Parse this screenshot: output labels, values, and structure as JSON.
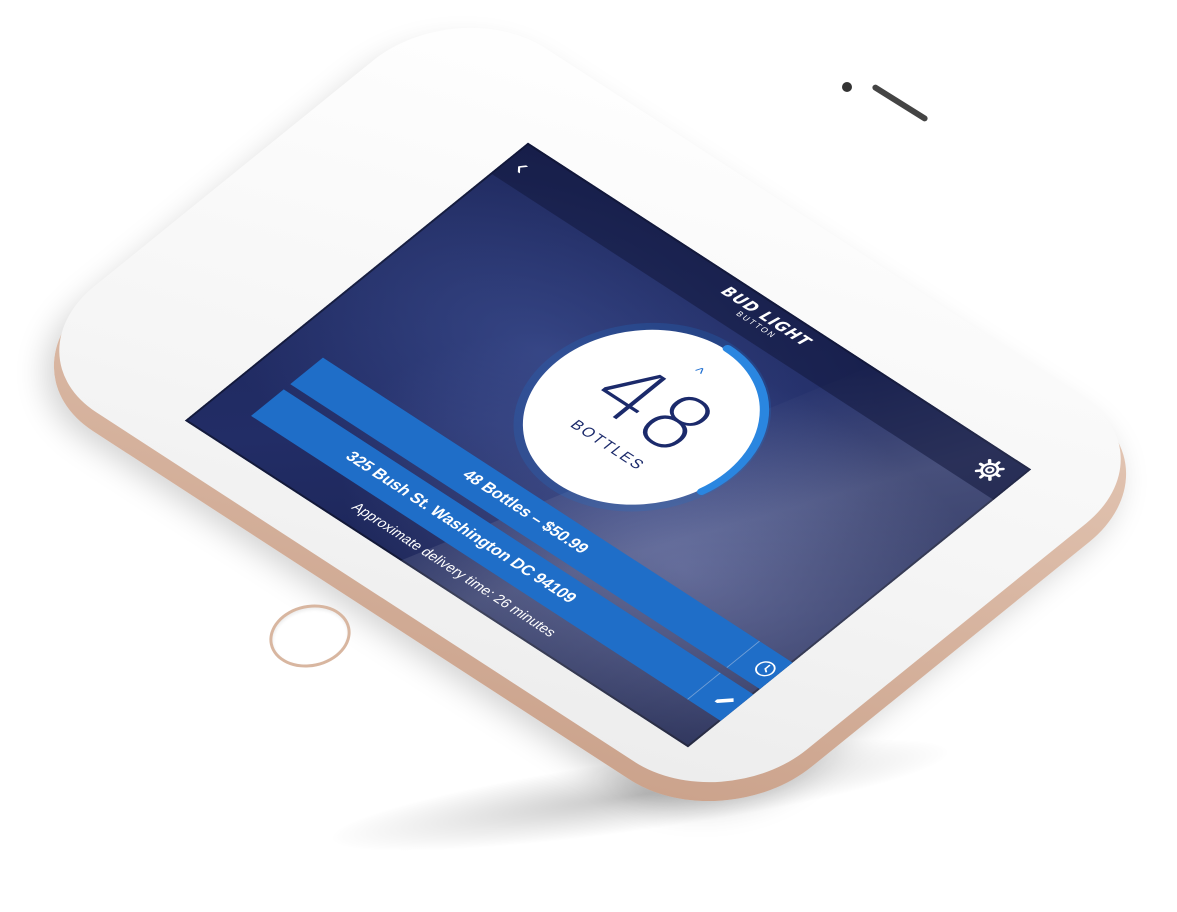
{
  "app": {
    "brand": "BUD LIGHT",
    "brand_sub": "BUTTON"
  },
  "counter": {
    "value": "48",
    "unit": "BOTTLES",
    "increment_icon": "chevron-up-icon"
  },
  "order": {
    "summary": "48 Bottles  –  $50.99",
    "address": "325 Bush St. Washington DC 94109",
    "delivery_text": "Approximate delivery time: 26 minutes"
  },
  "icons": {
    "back": "chevron-left-icon",
    "settings": "gear-icon",
    "clock": "clock-icon",
    "edit": "pencil-icon"
  },
  "colors": {
    "accent": "#1f6ec8",
    "counter_text": "#1b2a6b",
    "screen_bg": "#1b2457"
  }
}
